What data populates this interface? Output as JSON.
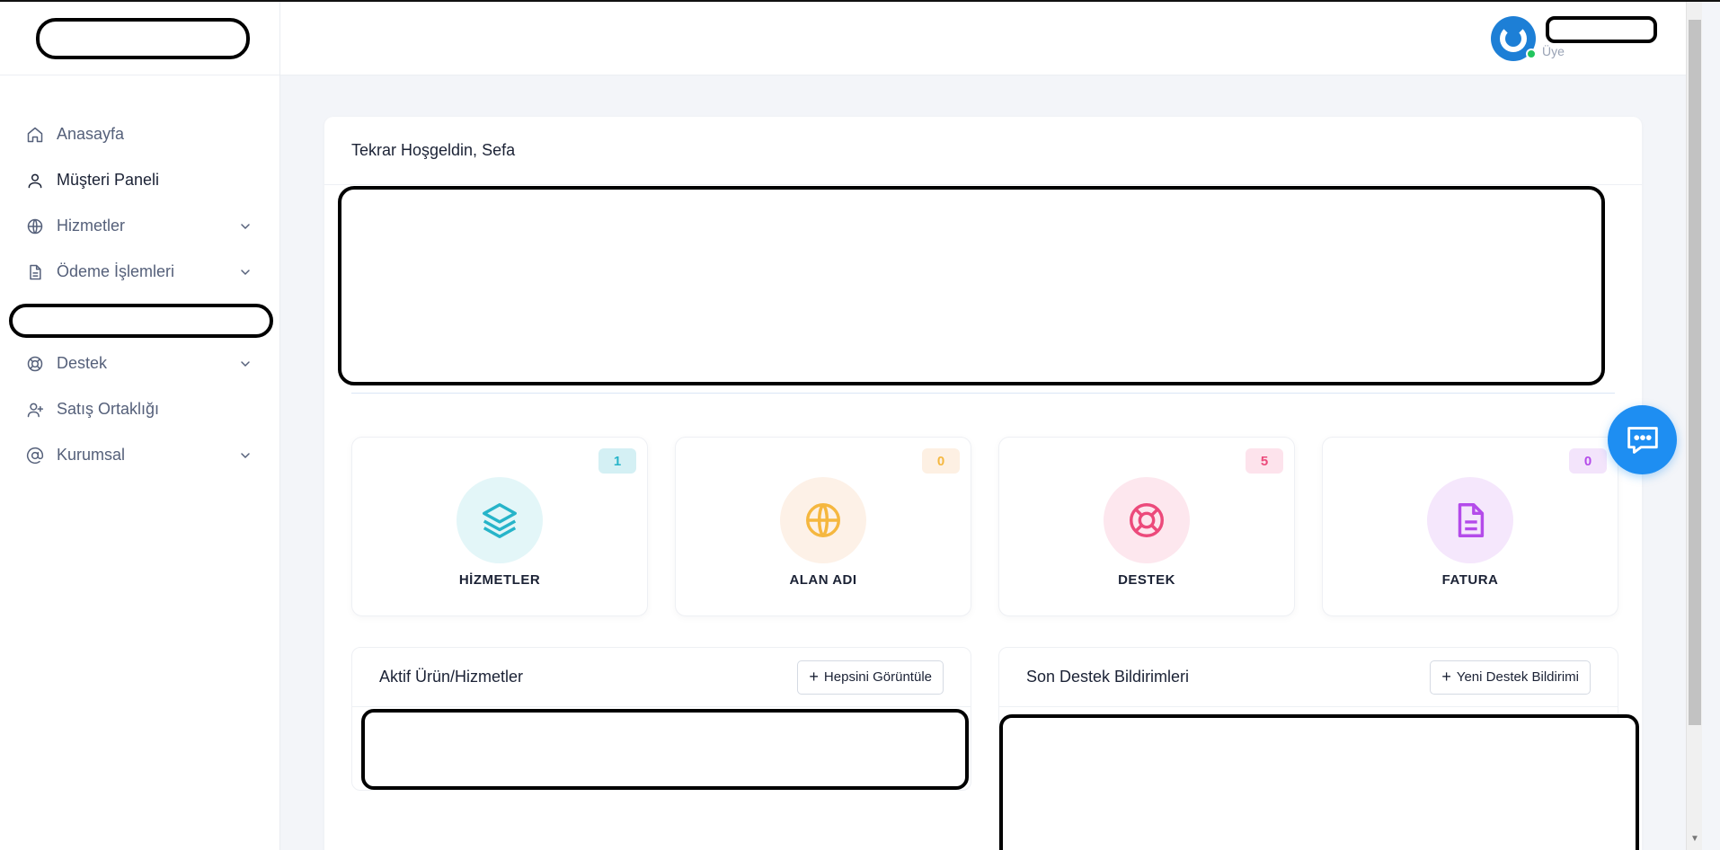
{
  "sidebar": {
    "items": [
      {
        "label": "Anasayfa",
        "icon": "home-icon"
      },
      {
        "label": "Müşteri Paneli",
        "icon": "user-icon"
      },
      {
        "label": "Hizmetler",
        "icon": "globe-icon"
      },
      {
        "label": "Ödeme İşlemleri",
        "icon": "document-icon"
      },
      {
        "label": "Destek",
        "icon": "lifebuoy-icon"
      },
      {
        "label": "Satış Ortaklığı",
        "icon": "user-plus-icon"
      },
      {
        "label": "Kurumsal",
        "icon": "at-icon"
      }
    ]
  },
  "header": {
    "user_role": "Üye"
  },
  "main": {
    "welcome": "Tekrar Hoşgeldin, Sefa",
    "stats": [
      {
        "title": "HİZMETLER",
        "count": "1",
        "color": "#27b4c9",
        "bg": "#e3f6f8",
        "badge_bg": "#d4f0f4",
        "icon": "layers-icon"
      },
      {
        "title": "ALAN ADI",
        "count": "0",
        "color": "#f5b73f",
        "bg": "#fdf1e7",
        "badge_bg": "#fdf0e3",
        "icon": "globe-icon"
      },
      {
        "title": "DESTEK",
        "count": "5",
        "color": "#ec4a7b",
        "bg": "#fde7ee",
        "badge_bg": "#fde3ec",
        "icon": "lifebuoy-icon"
      },
      {
        "title": "FATURA",
        "count": "0",
        "color": "#b44bea",
        "bg": "#f5e7fc",
        "badge_bg": "#f3e4fb",
        "icon": "document-icon"
      }
    ],
    "active_products": {
      "title": "Aktif Ürün/Hizmetler",
      "button": "Hepsini Görüntüle"
    },
    "support": {
      "title": "Son Destek Bildirimleri",
      "button": "Yeni Destek Bildirimi"
    }
  }
}
